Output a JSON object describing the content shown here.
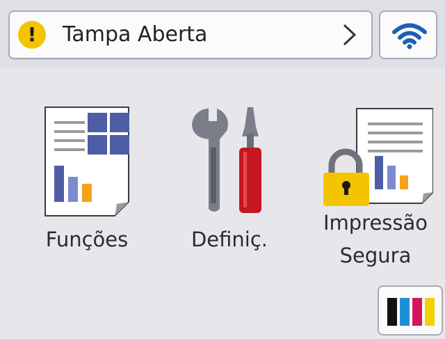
{
  "status": {
    "message": "Tampa Aberta",
    "warning_symbol": "!",
    "warning_color": "#f5c400",
    "icon": "warning-icon"
  },
  "wifi": {
    "icon": "wifi-icon",
    "color": "#1f5fb8"
  },
  "apps": [
    {
      "label": "Funções",
      "icon": "functions-icon"
    },
    {
      "label": "Definiç.",
      "icon": "settings-tools-icon"
    },
    {
      "label_line1": "Impressão",
      "label_line2": "Segura",
      "icon": "secure-print-icon"
    }
  ],
  "ink": {
    "icon": "ink-cartridges-icon",
    "colors": [
      "#111111",
      "#1c8fd6",
      "#d6145e",
      "#f3d000"
    ]
  }
}
